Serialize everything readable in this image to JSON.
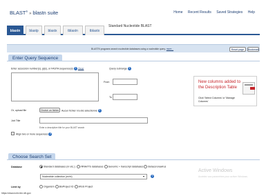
{
  "header": {
    "logo": "BLAST",
    "logo_sup": "®",
    "arrow": "»",
    "suite": "blastn suite",
    "nav": [
      "Home",
      "Recent Results",
      "Saved Strategies",
      "Help"
    ]
  },
  "tabs": [
    {
      "label": "blastn",
      "active": true
    },
    {
      "label": "blastp",
      "active": false
    },
    {
      "label": "blastx",
      "active": false
    },
    {
      "label": "tblastn",
      "active": false
    },
    {
      "label": "tblastx",
      "active": false
    }
  ],
  "page_title": "Standard Nucleotide BLAST",
  "description": {
    "text": "BLASTN programs search nucleotide databases using a nucleotide query.",
    "more": "more...",
    "reset_label": "Reset page",
    "bookmark_label": "Bookmark"
  },
  "query": {
    "section_title": "Enter Query Sequence",
    "accession_label": "Enter accession number(s), gi(s), or FASTA sequence(s)",
    "clear_label": "Clear",
    "subrange_label": "Query subrange",
    "from_label": "From",
    "to_label": "To",
    "upload_label": "Or, upload file",
    "choose_file_label": "Choisir un fichier",
    "no_file_text": "Aucun fichier n'a été sélectionné",
    "job_title_label": "Job Title",
    "job_title_hint": "Enter a descriptive title for your BLAST search",
    "align_label": "Align two or more sequences"
  },
  "promo": {
    "title": "New columns added to the Description Table",
    "text": "Click 'Select Columns' or 'Manage Columns'"
  },
  "search_set": {
    "section_title": "Choose Search Set",
    "database_label": "Database",
    "db_options": [
      {
        "label": "Standard databases (nr etc.):",
        "checked": true
      },
      {
        "label": "rRNA/ITS databases",
        "checked": false
      },
      {
        "label": "Genomic + transcript databases",
        "checked": false
      },
      {
        "label": "Betacoronavirus",
        "checked": false
      }
    ],
    "db_selected": "Nucleotide collection (nr/nt)",
    "limit_label": "Limit by",
    "limit_options": [
      {
        "label": "Organism",
        "checked": false
      },
      {
        "label": "BioProject ID",
        "checked": false
      },
      {
        "label": "WGS Project",
        "checked": false
      }
    ]
  },
  "overlay": {
    "title": "Active Windows",
    "subtitle": "Accédez aux paramètres pour activer Windows."
  },
  "status_url": "https://www.ncbi.nlm.nih.gov",
  "colors": {
    "brand": "#1e3f73",
    "tab_active": "#2a5894",
    "section_bg": "#c4d6ec",
    "promo_title": "#c6252b"
  }
}
